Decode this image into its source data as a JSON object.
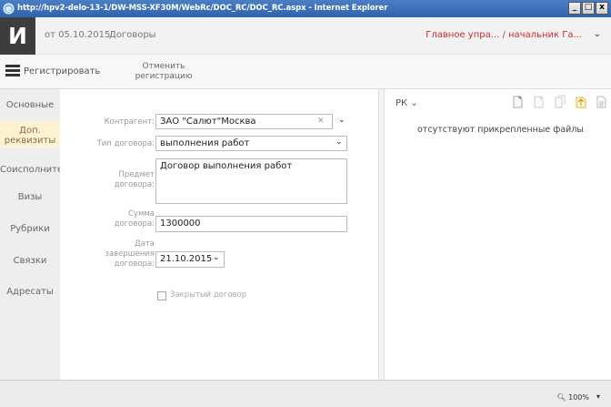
{
  "browser": {
    "url_title": "http://hpv2-delo-13-1/DW-MSS-XF30M/WebRc/DOC_RC/DOC_RC.aspx - Internet Explorer",
    "minimize": "_",
    "restore": "□",
    "close": "x"
  },
  "header": {
    "logo_letter": "И",
    "doc_date": "от 05.10.2015",
    "doc_type": "Договоры",
    "user": "Главное упра... / начальник Га...",
    "user_chevron": "⌄"
  },
  "toolbar": {
    "register_label": "Регистрировать",
    "cancel_label": "Отменить\nрегистрацию"
  },
  "tabs": {
    "main": "Основные",
    "extra": "Доп.\nреквизиты",
    "coexec": "Соисполнители",
    "visas": "Визы",
    "rubrics": "Рубрики",
    "links": "Связки",
    "addressees": "Адресаты"
  },
  "form": {
    "contractor_label": "Контрагент:",
    "contractor_value": "ЗАО \"Салют\"Москва",
    "contract_type_label": "Тип договора:",
    "contract_type_value": "выполнения работ",
    "subject_label": "Предмет\nдоговора:",
    "subject_value": "Договор выполнения работ",
    "sum_label": "Сумма\nдоговора:",
    "sum_value": "1300000",
    "end_date_label": "Дата\nзавершения\nдоговора:",
    "end_date_value": "21.10.2015",
    "closed_label": "Закрытый договор",
    "closed_checked": false
  },
  "files_panel": {
    "rk_label": "РК",
    "empty_text": "отсутствуют прикрепленные файлы"
  },
  "status": {
    "zoom": "100%"
  },
  "colors": {
    "accent_red": "#c62f2f",
    "active_tab_bg": "#fdf3d4"
  }
}
